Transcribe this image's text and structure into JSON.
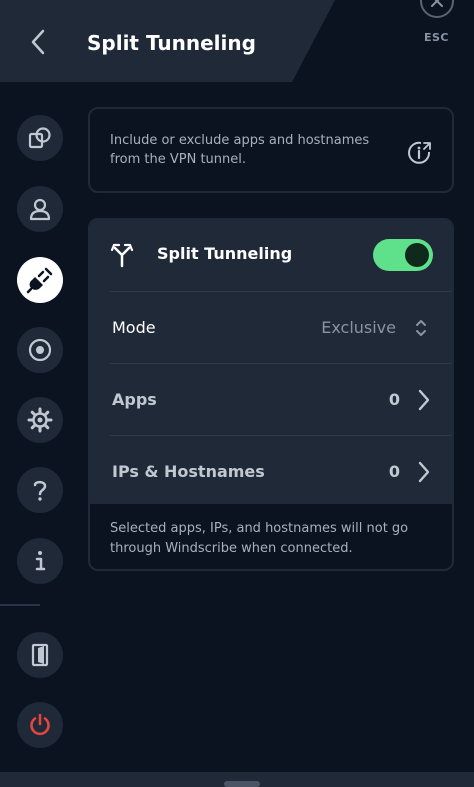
{
  "header": {
    "title": "Split Tunneling",
    "esc_label": "ESC"
  },
  "sidebar": {
    "items": [
      {
        "icon": "connection-icon",
        "active": false
      },
      {
        "icon": "account-icon",
        "active": false
      },
      {
        "icon": "split-tunneling-plug-icon",
        "active": true
      },
      {
        "icon": "robert-icon",
        "active": false
      },
      {
        "icon": "gear-icon",
        "active": false
      },
      {
        "icon": "help-icon",
        "active": false
      },
      {
        "icon": "about-icon",
        "active": false
      },
      {
        "icon": "logout-door-icon",
        "active": false
      },
      {
        "icon": "power-icon",
        "active": false
      }
    ]
  },
  "info": {
    "text": "Include or exclude apps and hostnames from the VPN tunnel."
  },
  "settings": {
    "split_tunneling_label": "Split Tunneling",
    "split_tunneling_enabled": true,
    "mode_label": "Mode",
    "mode_value": "Exclusive",
    "apps_label": "Apps",
    "apps_count": "0",
    "ips_label": "IPs & Hostnames",
    "ips_count": "0",
    "footer": "Selected apps, IPs, and hostnames will not go through Windscribe when connected."
  },
  "colors": {
    "background": "#0b1321",
    "panel": "#1f2938",
    "accent_green": "#5fe08a",
    "power_red": "#e3463d"
  }
}
